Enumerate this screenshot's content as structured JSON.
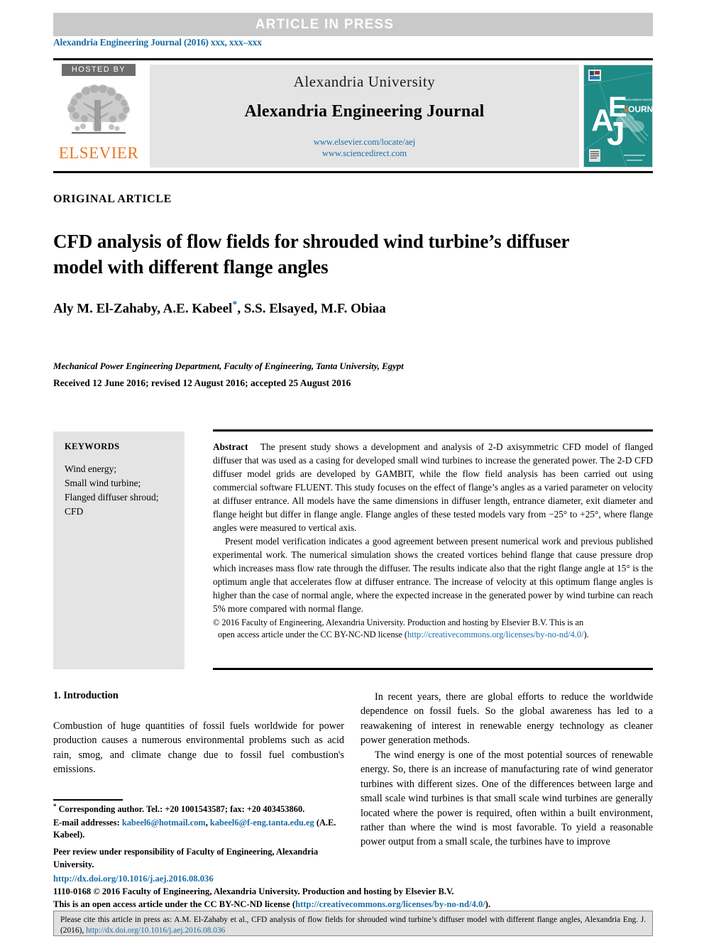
{
  "banner": {
    "article_in_press": "ARTICLE IN PRESS",
    "journal_reference": "Alexandria Engineering Journal (2016) xxx, xxx–xxx"
  },
  "masthead": {
    "hosted_by": "HOSTED BY",
    "publisher": "ELSEVIER",
    "university": "Alexandria University",
    "journal_title": "Alexandria Engineering Journal",
    "link_elsevier": "www.elsevier.com/locate/aej",
    "link_sciencedirect": "www.sciencedirect.com",
    "cover_letters": "AEJ",
    "cover_journal_word": "OURNAL",
    "cover_small_text": "ALEXANDRIA ENGINEERING"
  },
  "article": {
    "type_label": "ORIGINAL ARTICLE",
    "title": "CFD analysis of flow fields for shrouded wind turbine’s diffuser model with different flange angles",
    "authors": "Aly M. El-Zahaby, A.E. Kabeel",
    "authors_rest": ", S.S. Elsayed, M.F. Obiaa",
    "corresponding_marker": "*",
    "affiliation": "Mechanical Power Engineering Department, Faculty of Engineering, Tanta University, Egypt",
    "dates": "Received 12 June 2016; revised 12 August 2016; accepted 25 August 2016"
  },
  "keywords": {
    "heading": "KEYWORDS",
    "items": "Wind energy;\nSmall wind turbine;\nFlanged diffuser shroud;\nCFD"
  },
  "abstract": {
    "label": "Abstract",
    "paragraph_1": "The present study shows a development and analysis of 2-D axisymmetric CFD model of flanged diffuser that was used as a casing for developed small wind turbines to increase the generated power. The 2-D CFD diffuser model grids are developed by GAMBIT, while the flow field analysis has been carried out using commercial software FLUENT. This study focuses on the effect of flange’s angles as a varied parameter on velocity at diffuser entrance. All models have the same dimensions in diffuser length, entrance diameter, exit diameter and flange height but differ in flange angle. Flange angles of these tested models vary from −25° to +25°, where flange angles were measured to vertical axis.",
    "paragraph_2": "Present model verification indicates a good agreement between present numerical work and previous published experimental work. The numerical simulation shows the created vortices behind flange that cause pressure drop which increases mass flow rate through the diffuser. The results indicate also that the right flange angle at 15° is the optimum angle that accelerates flow at diffuser entrance. The increase of velocity at this optimum flange angles is higher than the case of normal angle, where the expected increase in the generated power by wind turbine can reach 5% more compared with normal flange.",
    "copyright_line_1": "© 2016 Faculty of Engineering, Alexandria University. Production and hosting by Elsevier B.V. This is an",
    "copyright_line_2_pre": "open access article under the CC BY-NC-ND license (",
    "copyright_license_url": "http://creativecommons.org/licenses/by-no-nd/4.0/",
    "copyright_line_2_post": ")."
  },
  "introduction": {
    "heading": "1. Introduction",
    "left_para_1": "Combustion of huge quantities of fossil fuels worldwide for power production causes a numerous environmental problems such as acid rain, smog, and climate change due to fossil fuel combustion's emissions.",
    "right_para_1": "In recent years, there are global efforts to reduce the worldwide dependence on fossil fuels. So the global awareness has led to a reawakening of interest in renewable energy technology as cleaner power generation methods.",
    "right_para_2": "The wind energy is one of the most potential sources of renewable energy. So, there is an increase of manufacturing rate of wind generator turbines with different sizes. One of the differences between large and small scale wind turbines is that small scale wind turbines are generally located where the power is required, often within a built environment, rather than where the wind is most favorable. To yield a reasonable power output from a small scale, the turbines have to improve"
  },
  "footnote": {
    "corresponding": "Corresponding author. Tel.: +20 1001543587; fax: +20 403453860.",
    "email_label": "E-mail addresses:",
    "email_1": "kabeel6@hotmail.com",
    "email_sep": ", ",
    "email_2": "kabeel6@f-eng.tanta.edu.eg",
    "email_owner": "(A.E. Kabeel).",
    "peer_review": "Peer review under responsibility of Faculty of Engineering, Alexandria University.",
    "doi": "http://dx.doi.org/10.1016/j.aej.2016.08.036",
    "issn_line_1": "1110-0168 © 2016 Faculty of Engineering, Alexandria University. Production and hosting by Elsevier B.V.",
    "issn_line_2_pre": "This is an open access article under the CC BY-NC-ND license (",
    "issn_license_url": "http://creativecommons.org/licenses/by-no-nd/4.0/",
    "issn_line_2_post": ")."
  },
  "citation_box": {
    "text_pre": "Please cite this article in press as: A.M. El-Zahaby et al., CFD analysis of flow fields for shrouded wind turbine’s diffuser model with different flange angles, Alexandria Eng. J. (2016), ",
    "doi_url": "http://dx.doi.org/10.1016/j.aej.2016.08.036"
  },
  "colors": {
    "banner_gray": "#c9c9c9",
    "panel_gray": "#e4e4e4",
    "link_blue": "#1a6ea8",
    "elsevier_orange": "#e87722",
    "cover_teal": "#1f8b86",
    "hosted_gray": "#6d6d6d"
  }
}
